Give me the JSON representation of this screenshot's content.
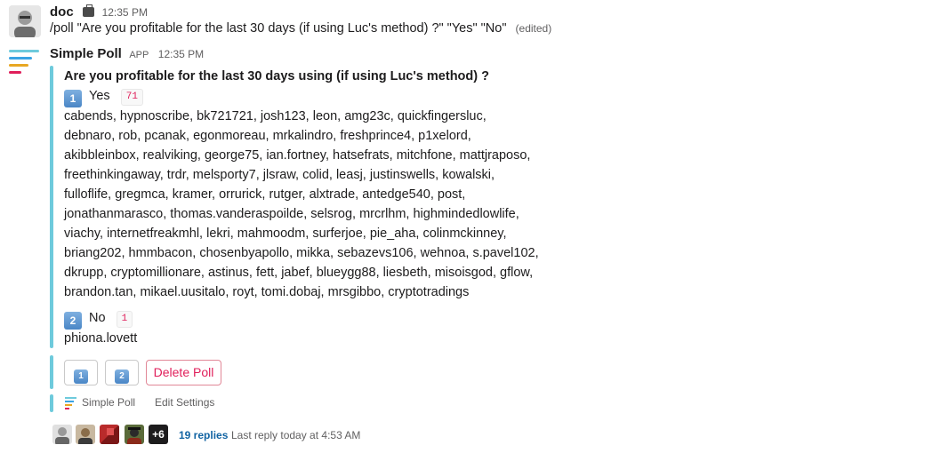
{
  "message1": {
    "author": "doc",
    "time": "12:35 PM",
    "text": "/poll \"Are you profitable for the last 30 days (if using Luc's method) ?\" \"Yes\" \"No\"",
    "edited": "(edited)"
  },
  "message2": {
    "author": "Simple Poll",
    "app_tag": "APP",
    "time": "12:35 PM",
    "question": "Are you profitable for the last 30 days using (if using Luc's method) ?",
    "options": [
      {
        "number": "1",
        "label": "Yes",
        "count": "71",
        "voters": [
          "cabends, hypnoscribe, bk721721, josh123, leon, amg23c, quickfingersluc,",
          "debnaro, rob, pcanak, egonmoreau, mrkalindro, freshprince4, p1xelord,",
          "akibbleinbox, realviking, george75, ian.fortney, hatsefrats, mitchfone, mattjraposo,",
          "freethinkingaway, trdr, melsporty7, jlsraw, colid, leasj, justinswells, kowalski,",
          "fulloflife, gregmca, kramer, orrurick, rutger, alxtrade, antedge540, post,",
          "jonathanmarasco, thomas.vanderaspoilde, selsrog, mrcrlhm, highmindedlowlife,",
          "viachy, internetfreakmhl, lekri, mahmoodm, surferjoe, pie_aha, colinmckinney,",
          "briang202, hmmbacon, chosenbyapollo, mikka, sebazevs106, wehnoa, s.pavel102,",
          "dkrupp, cryptomillionare, astinus, fett, jabef, blueygg88, liesbeth, misoisgod, gflow,",
          "brandon.tan, mikael.uusitalo, royt, tomi.dobaj, mrsgibbo, cryptotradings"
        ]
      },
      {
        "number": "2",
        "label": "No",
        "count": "1",
        "voters": [
          "phiona.lovett"
        ]
      }
    ],
    "buttons": {
      "vote1": "1",
      "vote2": "2",
      "delete": "Delete Poll"
    },
    "footer": {
      "app_name": "Simple Poll",
      "edit_settings": "Edit Settings"
    },
    "thread": {
      "more_count": "+6",
      "replies": "19 replies",
      "last_reply": "Last reply today at 4:53 AM"
    }
  }
}
